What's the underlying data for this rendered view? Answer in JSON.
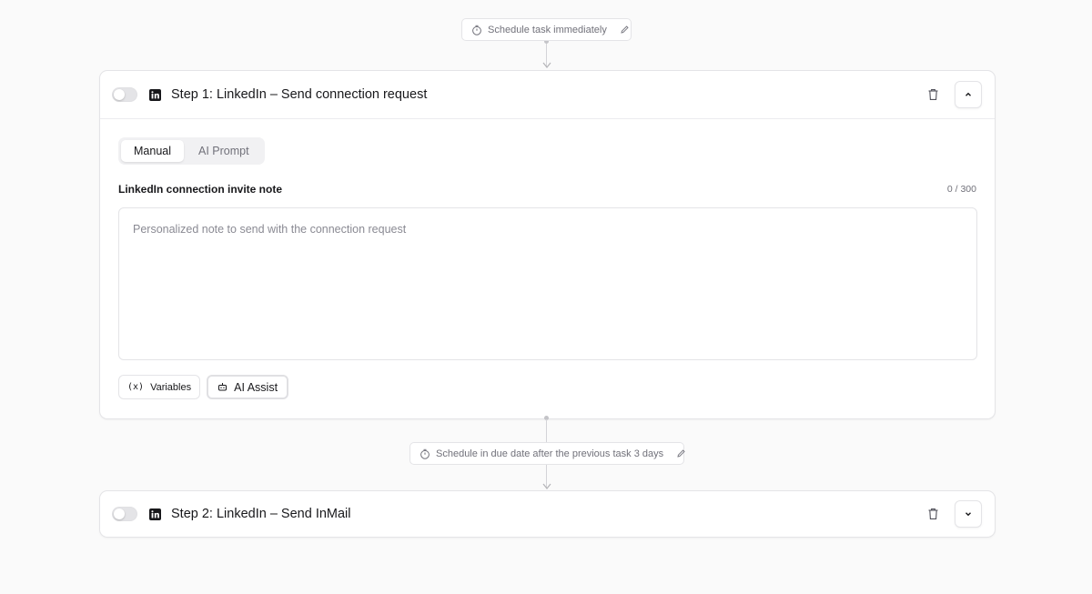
{
  "schedule_1": {
    "label": "Schedule task immediately"
  },
  "schedule_2": {
    "label": "Schedule in due date after the previous task 3 days"
  },
  "step_1": {
    "title": "Step 1: LinkedIn – Send connection request",
    "tabs": [
      {
        "label": "Manual",
        "active": true
      },
      {
        "label": "AI Prompt",
        "active": false
      }
    ],
    "field_label": "LinkedIn connection invite note",
    "counter": "0 / 300",
    "textarea": {
      "value": "",
      "placeholder": "Personalized note to send with the connection request"
    },
    "variables_label": "Variables",
    "variables_glyph": "(x)",
    "ai_assist_label": "AI Assist",
    "expanded": true
  },
  "step_2": {
    "title": "Step 2: LinkedIn – Send InMail",
    "expanded": false
  },
  "icons": {
    "timer": "timer-icon",
    "pencil": "pencil-icon",
    "linkedin": "linkedin-icon",
    "trash": "trash-icon",
    "chevron_up": "chevron-up-icon",
    "chevron_down": "chevron-down-icon",
    "ai": "robot-icon"
  },
  "colors": {
    "background": "#fafafa",
    "card": "#ffffff",
    "border": "#e4e4e7",
    "text": "#18181b",
    "muted": "#71717a"
  }
}
